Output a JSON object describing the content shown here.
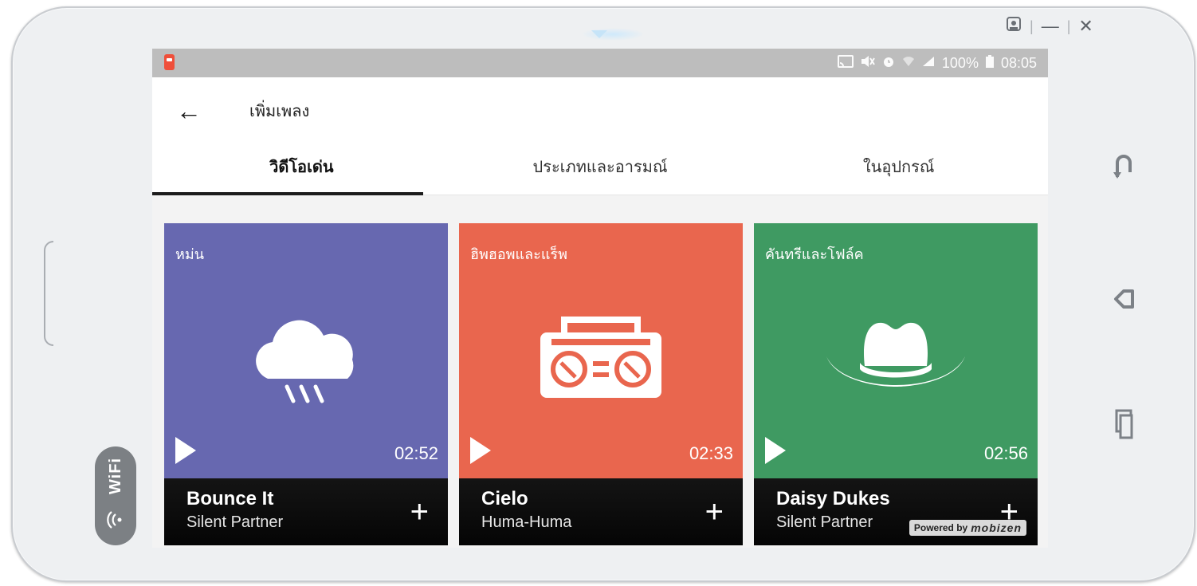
{
  "window": {
    "controls": [
      {
        "icon": "person-icon",
        "label": ""
      },
      {
        "icon": "minimize-icon",
        "label": "—"
      },
      {
        "icon": "close-icon",
        "label": "✕"
      }
    ]
  },
  "device_nav": {
    "buttons": [
      {
        "icon": "rotate-icon",
        "glyph": "⤺"
      },
      {
        "icon": "back-nav-icon",
        "glyph": "◁"
      },
      {
        "icon": "recent-apps-icon",
        "glyph": "⧉"
      }
    ]
  },
  "wifi_badge": {
    "label": "WiFi",
    "icon_glyph": "((•"
  },
  "status_bar": {
    "battery": "100%",
    "time": "08:05",
    "icons": [
      "cast-icon",
      "mute-icon",
      "alarm-icon",
      "wifi-signal-icon",
      "cell-signal-icon",
      "battery-icon"
    ]
  },
  "app_bar": {
    "back_glyph": "←",
    "title": "เพิ่มเพลง"
  },
  "tabs": [
    {
      "label": "วิดีโอเด่น",
      "active": true
    },
    {
      "label": "ประเภทและอารมณ์",
      "active": false
    },
    {
      "label": "ในอุปกรณ์",
      "active": false
    }
  ],
  "cards": [
    {
      "genre": "หม่น",
      "icon": "rain-cloud-icon",
      "color": "#6768b0",
      "duration": "02:52",
      "track": "Bounce It",
      "artist": "Silent Partner"
    },
    {
      "genre": "ฮิพฮอพและแร็พ",
      "icon": "boombox-icon",
      "color": "#e9664e",
      "duration": "02:33",
      "track": "Cielo",
      "artist": "Huma-Huma"
    },
    {
      "genre": "คันทรีและโฟล์ค",
      "icon": "cowboy-hat-icon",
      "color": "#3f9a62",
      "duration": "02:56",
      "track": "Daisy Dukes",
      "artist": "Silent Partner"
    }
  ],
  "watermark": {
    "prefix": "Powered by",
    "brand": "mobizen"
  }
}
